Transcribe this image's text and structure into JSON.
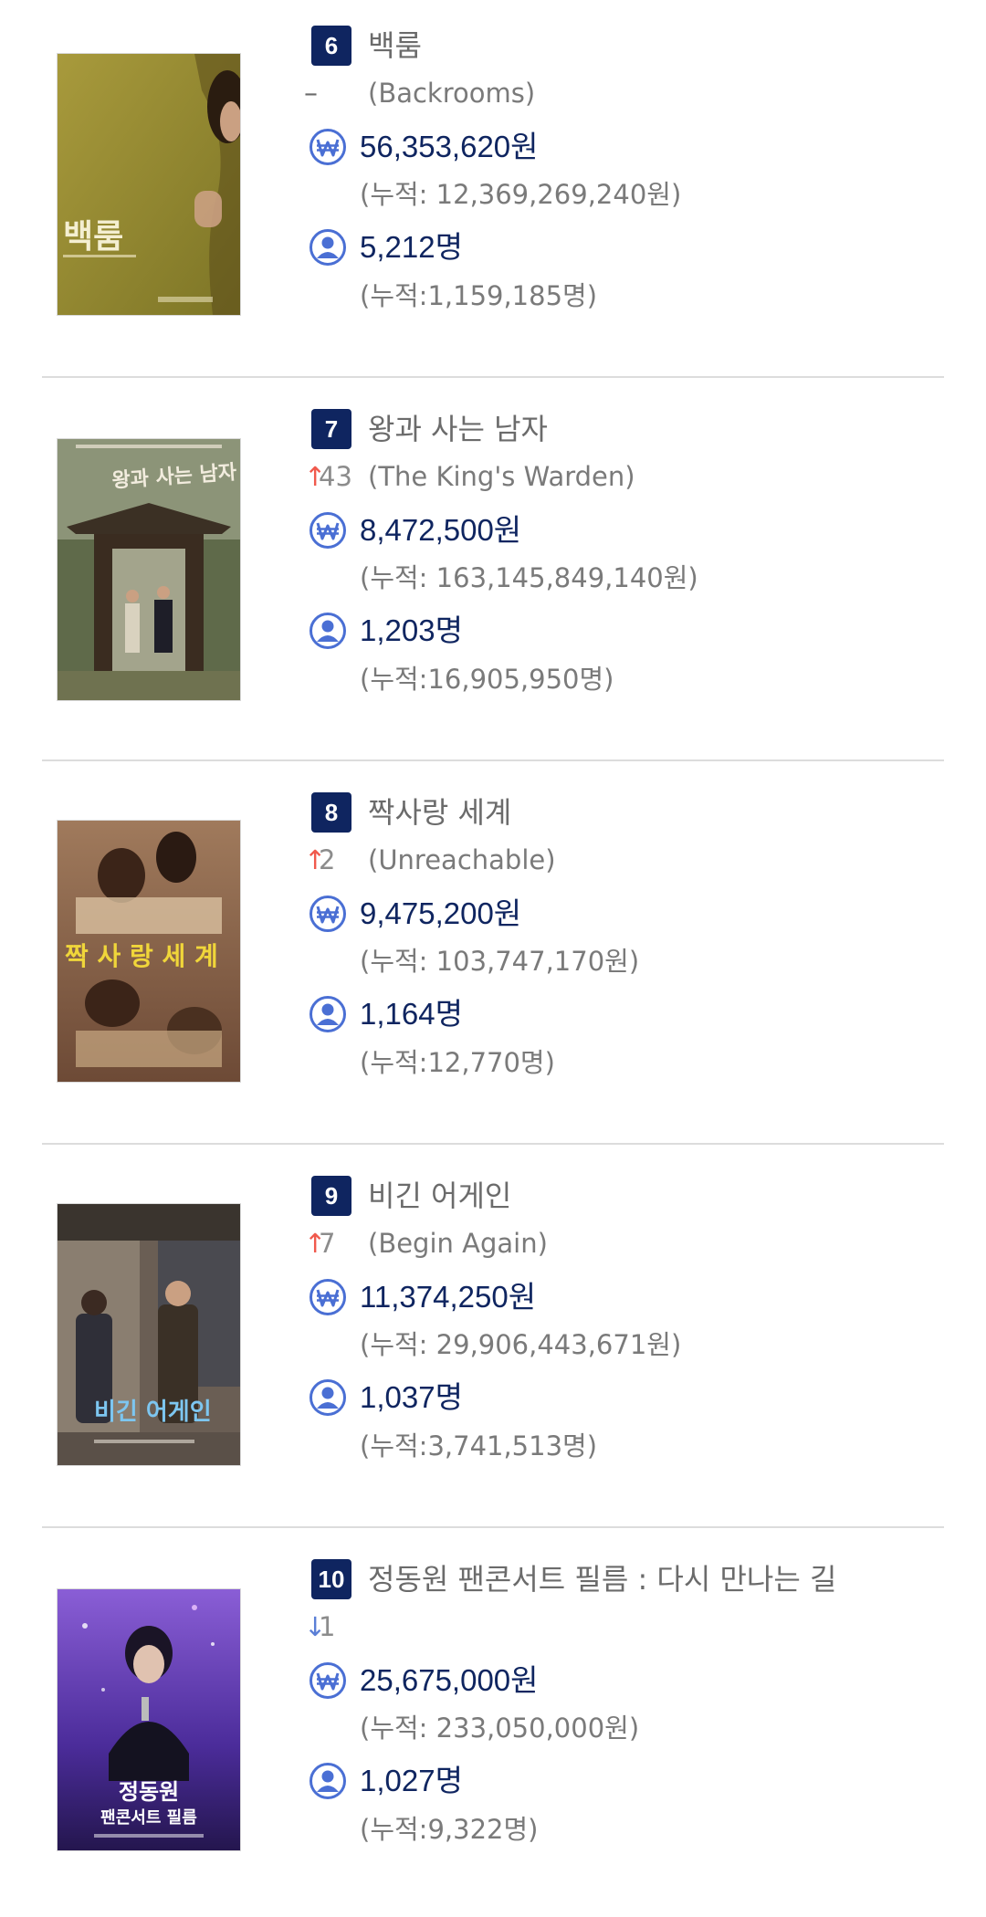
{
  "entries": [
    {
      "rank": "6",
      "title_ko": "백룸",
      "change_dir": "same",
      "change_arrow": "–",
      "change_value": "",
      "title_en": "(Backrooms)",
      "revenue": "56,353,620원",
      "revenue_cumulative": "(누적: 12,369,269,240원)",
      "audience": "5,212명",
      "audience_cumulative": "(누적:1,159,185명)",
      "poster_title": "백룸"
    },
    {
      "rank": "7",
      "title_ko": "왕과 사는 남자",
      "change_dir": "up",
      "change_arrow": "↑",
      "change_value": "43",
      "title_en": "(The King's Warden)",
      "revenue": "8,472,500원",
      "revenue_cumulative": "(누적: 163,145,849,140원)",
      "audience": "1,203명",
      "audience_cumulative": "(누적:16,905,950명)",
      "poster_title": "왕과 사는 남자"
    },
    {
      "rank": "8",
      "title_ko": "짝사랑 세계",
      "change_dir": "up",
      "change_arrow": "↑",
      "change_value": "2",
      "title_en": "(Unreachable)",
      "revenue": "9,475,200원",
      "revenue_cumulative": "(누적: 103,747,170원)",
      "audience": "1,164명",
      "audience_cumulative": "(누적:12,770명)",
      "poster_title": "짝 사 랑 세 계"
    },
    {
      "rank": "9",
      "title_ko": "비긴 어게인",
      "change_dir": "up",
      "change_arrow": "↑",
      "change_value": "7",
      "title_en": "(Begin Again)",
      "revenue": "11,374,250원",
      "revenue_cumulative": "(누적: 29,906,443,671원)",
      "audience": "1,037명",
      "audience_cumulative": "(누적:3,741,513명)",
      "poster_title": "비긴 어게인"
    },
    {
      "rank": "10",
      "title_ko": "정동원 팬콘서트 필름 : 다시 만나는 길",
      "change_dir": "down",
      "change_arrow": "↓",
      "change_value": "1",
      "title_en": "",
      "revenue": "25,675,000원",
      "revenue_cumulative": "(누적: 233,050,000원)",
      "audience": "1,027명",
      "audience_cumulative": "(누적:9,322명)",
      "poster_title": "정동원",
      "poster_subtitle": "팬콘서트 필름"
    }
  ],
  "icons": {
    "revenue": "won-icon",
    "audience": "person-icon"
  },
  "colors": {
    "navy": "#0f2560",
    "icon_blue": "#4a6fd4",
    "up": "#f05a4d",
    "down": "#5b7fd6",
    "muted": "#7a7a7a"
  }
}
